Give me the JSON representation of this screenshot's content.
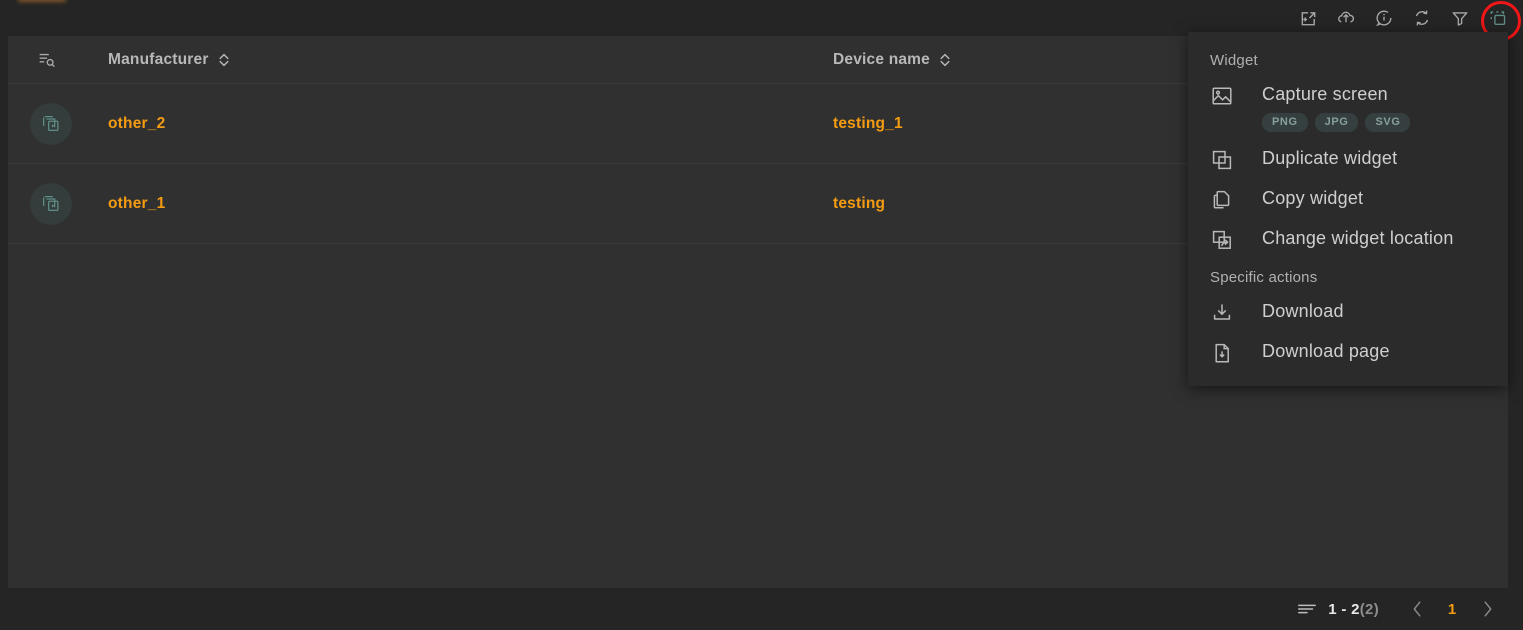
{
  "colors": {
    "page_bg": "#252525",
    "panel_bg": "#303030",
    "menu_bg": "#2b2b2b",
    "accent_orange": "#f39c12",
    "accent_teal": "#5f8e87",
    "highlight_ring": "#f21616",
    "text_muted": "#b0b0b0"
  },
  "toolbar": {
    "buttons": [
      {
        "name": "add-to-dashboard-icon",
        "title": "Add to dashboard"
      },
      {
        "name": "upload-cloud-icon",
        "title": "Upload"
      },
      {
        "name": "info-icon",
        "title": "Information"
      },
      {
        "name": "refresh-icon",
        "title": "Refresh"
      },
      {
        "name": "filter-icon",
        "title": "Filter"
      },
      {
        "name": "widget-actions-icon",
        "title": "Widget actions"
      }
    ],
    "active_button": "widget-actions-icon"
  },
  "table": {
    "header_search_icon": "list-search-icon",
    "columns": [
      {
        "label": "Manufacturer",
        "sortable": true
      },
      {
        "label": "Device name",
        "sortable": true
      }
    ],
    "rows": [
      {
        "row_icon": "widget-stack-play-icon",
        "manufacturer": "other_2",
        "device_name": "testing_1"
      },
      {
        "row_icon": "widget-stack-play-icon",
        "manufacturer": "other_1",
        "device_name": "testing"
      }
    ]
  },
  "pagination": {
    "rows_icon": "rows-per-page-icon",
    "range": "1 - 2",
    "total": "(2)",
    "prev_label": "‹",
    "next_label": "›",
    "current_page": "1"
  },
  "context_menu": {
    "sections": [
      {
        "title": "Widget",
        "items": [
          {
            "icon": "image-icon",
            "label": "Capture screen",
            "chips": [
              "PNG",
              "JPG",
              "SVG"
            ]
          },
          {
            "icon": "duplicate-icon",
            "label": "Duplicate widget",
            "chips": []
          },
          {
            "icon": "copy-icon",
            "label": "Copy widget",
            "chips": []
          },
          {
            "icon": "move-location-icon",
            "label": "Change widget location",
            "chips": []
          }
        ]
      },
      {
        "title": "Specific actions",
        "items": [
          {
            "icon": "download-icon",
            "label": "Download",
            "chips": []
          },
          {
            "icon": "download-page-icon",
            "label": "Download page",
            "chips": []
          }
        ]
      }
    ]
  }
}
